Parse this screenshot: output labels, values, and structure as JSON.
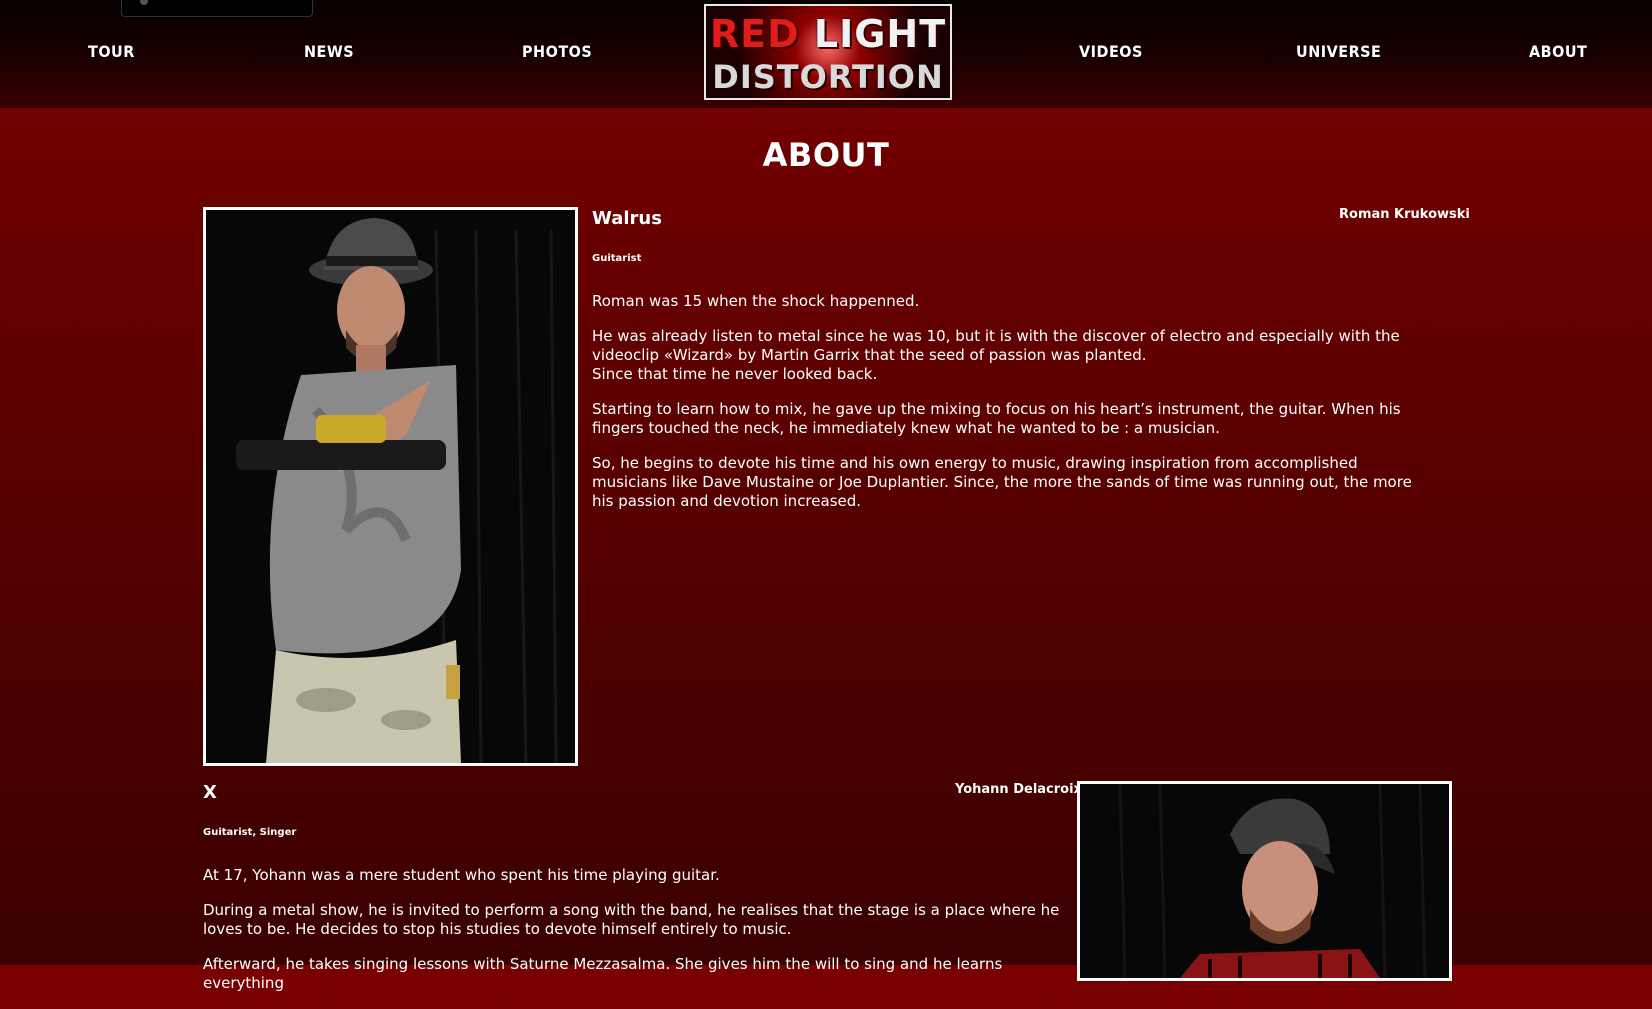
{
  "nav": {
    "items_left": [
      "Tour",
      "News",
      "Photos"
    ],
    "items_right": [
      "Videos",
      "Universe",
      "About"
    ],
    "logo_line1_red": "RED ",
    "logo_line1_white": "LIGHT",
    "logo_line2": "DISTORTION"
  },
  "page_title": "About",
  "members": [
    {
      "nickname": "Walrus",
      "real_name": "Roman Krukowski",
      "role": "Guitarist",
      "bio": [
        "Roman was 15 when the shock happenned.",
        "He was already listen to metal since he was 10, but it is with the discover of electro and especially with the videoclip «Wizard» by Martin Garrix that the seed of passion was planted.",
        "Since that time he never looked back.",
        "Starting to learn how to mix, he gave up the mixing to focus on his heart’s instrument, the guitar. When his fingers touched the neck, he immediately knew what he wanted to be : a musician.",
        "So, he begins to devote his time and his own energy to music, drawing inspiration from accomplished musicians like Dave Mustaine or Joe Duplantier. Since, the more the sands of time was running out, the more his passion and devotion increased."
      ]
    },
    {
      "nickname": "X",
      "real_name": "Yohann Delacroix",
      "role": "Guitarist, Singer",
      "bio": [
        "At 17, Yohann was a mere student who spent his time playing guitar.",
        "During a metal show, he is invited to perform a song with the band, he realises that the stage is a place where he loves to be. He decides to stop his studies to devote himself entirely to music.",
        "Afterward, he takes singing lessons with Saturne Mezzasalma. She gives him the will to sing and he learns everything"
      ]
    }
  ],
  "colors": {
    "header_bg": "#0a0000",
    "page_bg": "#6a0000",
    "logo_red": "#e21b1b",
    "text": "#ffffff"
  }
}
